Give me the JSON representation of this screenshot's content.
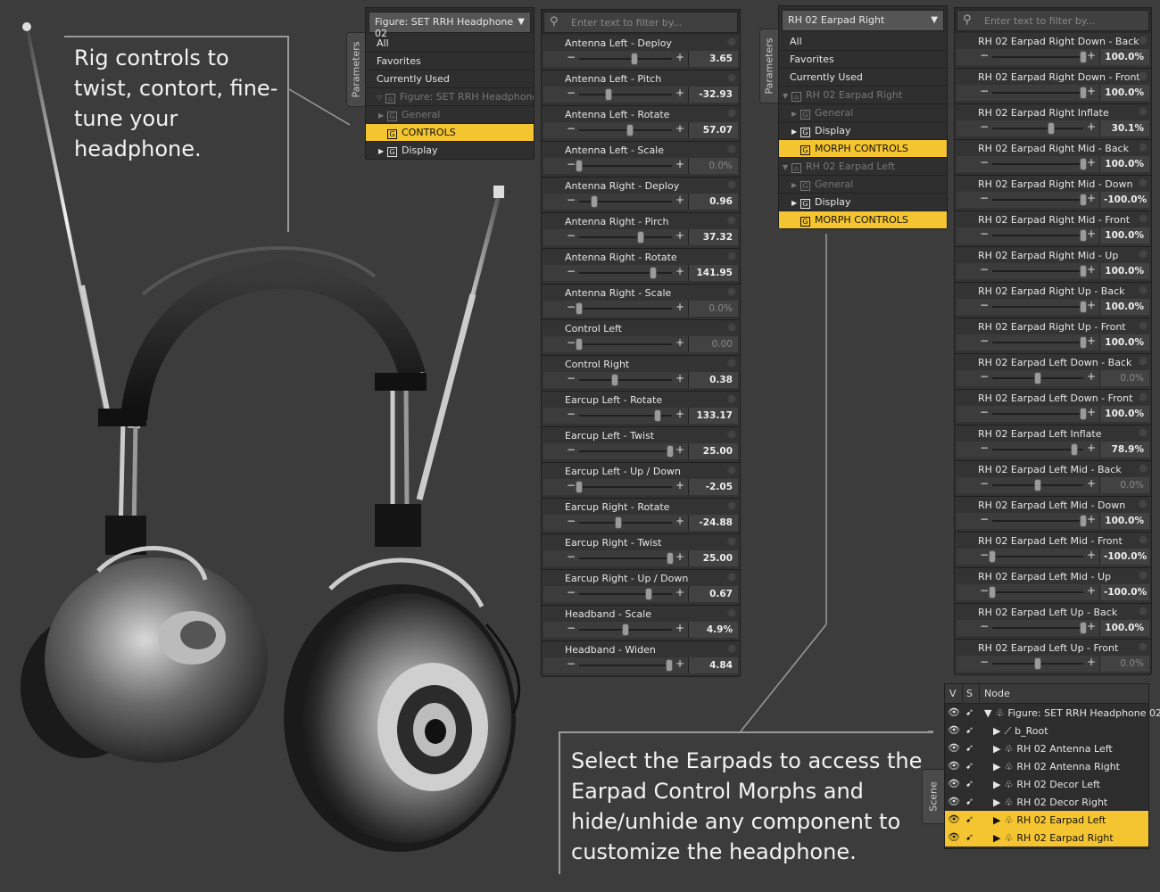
{
  "captions": {
    "rig": "Rig controls to twist, contort, fine-tune your headphone.",
    "earpads": "Select the Earpads to access the Earpad Control Morphs and hide/unhide any component to customize the headphone."
  },
  "colors": {
    "selection": "#f5c531",
    "panel": "#2d2d2d",
    "background": "#3c3c3c"
  },
  "tabs": {
    "parameters": "Parameters",
    "scene": "Scene"
  },
  "tree_left": {
    "dropdown": "Figure: SET RRH Headphone 02",
    "rows": [
      {
        "label": "All"
      },
      {
        "label": "Favorites"
      },
      {
        "label": "Currently Used"
      },
      {
        "label": "Figure: SET RRH Headphone 02"
      },
      {
        "label": "General"
      },
      {
        "label": "CONTROLS"
      },
      {
        "label": "Display"
      }
    ]
  },
  "tree_right": {
    "dropdown": "RH 02 Earpad Right",
    "rows": [
      {
        "label": "All"
      },
      {
        "label": "Favorites"
      },
      {
        "label": "Currently Used"
      },
      {
        "label": "RH 02 Earpad Right"
      },
      {
        "label": "General"
      },
      {
        "label": "Display"
      },
      {
        "label": "MORPH CONTROLS"
      },
      {
        "label": "RH 02 Earpad Left"
      },
      {
        "label": "General"
      },
      {
        "label": "Display"
      },
      {
        "label": "MORPH CONTROLS"
      }
    ]
  },
  "filter_placeholder": "Enter text to filter by...",
  "sliders_left": [
    {
      "label": "Antenna Left - Deploy",
      "value": "3.65",
      "pos": 0.6
    },
    {
      "label": "Antenna Left - Pitch",
      "value": "-32.93",
      "pos": 0.32
    },
    {
      "label": "Antenna Left - Rotate",
      "value": "57.07",
      "pos": 0.55
    },
    {
      "label": "Antenna Left - Scale",
      "value": "0.0%",
      "pos": 0.0
    },
    {
      "label": "Antenna Right - Deploy",
      "value": "0.96",
      "pos": 0.16
    },
    {
      "label": "Antenna Right - Pirch",
      "value": "37.32",
      "pos": 0.66
    },
    {
      "label": "Antenna Right - Rotate",
      "value": "141.95",
      "pos": 0.8
    },
    {
      "label": "Antenna Right - Scale",
      "value": "0.0%",
      "pos": 0.0
    },
    {
      "label": "Control Left",
      "value": "0.00",
      "pos": 0.0
    },
    {
      "label": "Control Right",
      "value": "0.38",
      "pos": 0.38
    },
    {
      "label": "Earcup Left - Rotate",
      "value": "133.17",
      "pos": 0.85
    },
    {
      "label": "Earcup Left - Twist",
      "value": "25.00",
      "pos": 0.98
    },
    {
      "label": "Earcup Left - Up / Down",
      "value": "-2.05",
      "pos": 0.0
    },
    {
      "label": "Earcup Right - Rotate",
      "value": "-24.88",
      "pos": 0.42
    },
    {
      "label": "Earcup Right - Twist",
      "value": "25.00",
      "pos": 0.98
    },
    {
      "label": "Earcup Right - Up / Down",
      "value": "0.67",
      "pos": 0.75
    },
    {
      "label": "Headband - Scale",
      "value": "4.9%",
      "pos": 0.5
    },
    {
      "label": "Headband - Widen",
      "value": "4.84",
      "pos": 0.97
    }
  ],
  "sliders_right": [
    {
      "label": "RH 02 Earpad Right Down - Back",
      "value": "100.0%",
      "pos": 1.0
    },
    {
      "label": "RH 02 Earpad Right Down - Front",
      "value": "100.0%",
      "pos": 1.0
    },
    {
      "label": "RH 02 Earpad Right Inflate",
      "value": "30.1%",
      "pos": 0.65
    },
    {
      "label": "RH 02 Earpad Right Mid - Back",
      "value": "100.0%",
      "pos": 1.0
    },
    {
      "label": "RH 02 Earpad Right Mid - Down",
      "value": "-100.0%",
      "pos": 1.0
    },
    {
      "label": "RH 02 Earpad Right Mid - Front",
      "value": "100.0%",
      "pos": 1.0
    },
    {
      "label": "RH 02 Earpad Right Mid - Up",
      "value": "100.0%",
      "pos": 1.0
    },
    {
      "label": "RH 02 Earpad Right Up - Back",
      "value": "100.0%",
      "pos": 1.0
    },
    {
      "label": "RH 02 Earpad Right Up - Front",
      "value": "100.0%",
      "pos": 1.0
    },
    {
      "label": "RH 02 Earpad Left Down - Back",
      "value": "0.0%",
      "pos": 0.5
    },
    {
      "label": "RH 02 Earpad Left Down - Front",
      "value": "100.0%",
      "pos": 1.0
    },
    {
      "label": "RH 02 Earpad Left Inflate",
      "value": "78.9%",
      "pos": 0.9
    },
    {
      "label": "RH 02 Earpad Left Mid - Back",
      "value": "0.0%",
      "pos": 0.5
    },
    {
      "label": "RH 02 Earpad Left Mid - Down",
      "value": "100.0%",
      "pos": 1.0
    },
    {
      "label": "RH 02 Earpad Left Mid - Front",
      "value": "-100.0%",
      "pos": 0.0
    },
    {
      "label": "RH 02 Earpad Left Mid - Up",
      "value": "-100.0%",
      "pos": 0.0
    },
    {
      "label": "RH 02 Earpad Left Up - Back",
      "value": "100.0%",
      "pos": 1.0
    },
    {
      "label": "RH 02 Earpad Left Up - Front",
      "value": "0.0%",
      "pos": 0.5
    }
  ],
  "scene": {
    "col_v": "V",
    "col_s": "S",
    "col_node": "Node",
    "nodes": [
      {
        "label": "Figure: SET RRH Headphone 02"
      },
      {
        "label": "b_Root"
      },
      {
        "label": "RH 02 Antenna Left"
      },
      {
        "label": "RH 02 Antenna Right"
      },
      {
        "label": "RH 02 Decor Left"
      },
      {
        "label": "RH 02 Decor Right"
      },
      {
        "label": "RH 02 Earpad Left"
      },
      {
        "label": "RH 02 Earpad Right"
      }
    ]
  }
}
